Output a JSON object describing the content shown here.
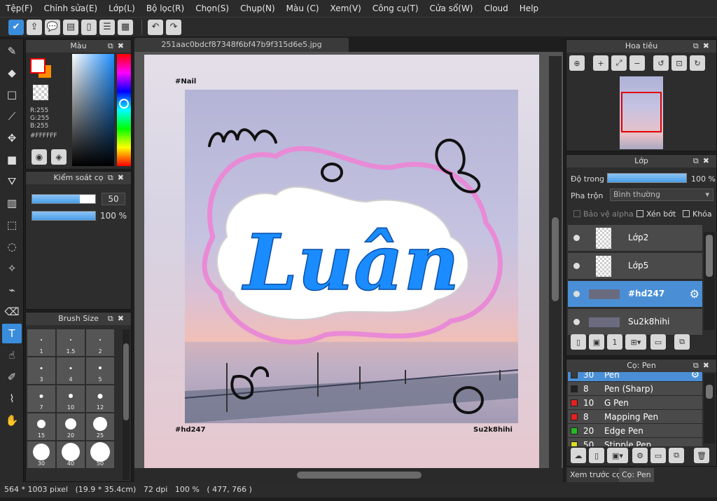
{
  "menu": [
    "Tệp(F)",
    "Chỉnh sửa(E)",
    "Lớp(L)",
    "Bộ lọc(R)",
    "Chọn(S)",
    "Chụp(N)",
    "Màu (C)",
    "Xem(V)",
    "Công cụ(T)",
    "Cửa sổ(W)",
    "Cloud",
    "Help"
  ],
  "toolbar": {
    "icons": [
      "check-icon",
      "share-icon",
      "speech-bubble-icon",
      "comment-icon",
      "page-icon",
      "list-icon",
      "grid-edit-icon",
      "undo-icon",
      "redo-icon"
    ]
  },
  "tools": [
    "brush-icon",
    "eraser-icon",
    "rect-icon",
    "line-icon",
    "move-icon",
    "fill-rect-icon",
    "bucket-icon",
    "gradient-icon",
    "select-rect-icon",
    "lasso-icon",
    "magic-wand-icon",
    "select-pen-icon",
    "select-eraser-icon",
    "text-icon",
    "hand-pointer-icon",
    "dropper-edit-icon",
    "eyedropper-icon",
    "hand-icon"
  ],
  "color_panel": {
    "title": "Màu",
    "r": "R:255",
    "g": "G:255",
    "b": "B:255",
    "hex": "#FFFFFF",
    "fg_color": "#ffffff",
    "bg_color": "#ff8c00"
  },
  "brush_control": {
    "title": "Kiểm soát cọ",
    "size_value": "50",
    "opacity_value": "100 %"
  },
  "brush_size": {
    "title": "Brush Size",
    "sizes": [
      "1",
      "1.5",
      "2",
      "3",
      "4",
      "5",
      "7",
      "10",
      "12",
      "15",
      "20",
      "25",
      "30",
      "40",
      "50"
    ]
  },
  "document": {
    "tab": "251aac0bdcf87348f6bf47b9f315d6e5.jpg",
    "tag_top": "#Nail",
    "tag_bottom_left": "#hd247",
    "tag_bottom_right": "Su2k8hihi",
    "title_text": "Luân",
    "accent_blue": "#1a8cff",
    "accent_pink": "#e98ad6"
  },
  "status": {
    "dimensions": "564 * 1003 pixel",
    "physical": "(19.9 * 35.4cm)",
    "dpi": "72 dpi",
    "zoom": "100 %",
    "coords": "( 477, 766 )"
  },
  "navigator": {
    "title": "Hoa tiêu"
  },
  "layers": {
    "title": "Lớp",
    "opacity_label": "Độ trong",
    "opacity_value": "100 %",
    "blend_label": "Pha trộn",
    "blend_value": "Bình thường",
    "protect_alpha": "Bảo vệ alpha",
    "clip": "Xén bớt",
    "lock": "Khóa",
    "items": [
      {
        "name": "Lớp2",
        "selected": false
      },
      {
        "name": "Lớp5",
        "selected": false
      },
      {
        "name": "#hd247",
        "selected": true
      },
      {
        "name": "Su2k8hihi",
        "selected": false
      }
    ]
  },
  "brushes": {
    "title": "Cọ: Pen",
    "items": [
      {
        "size": "30",
        "name": "Pen",
        "color": "#3a3a3a"
      },
      {
        "size": "8",
        "name": "Pen (Sharp)",
        "color": "#222222"
      },
      {
        "size": "10",
        "name": "G Pen",
        "color": "#e82020"
      },
      {
        "size": "8",
        "name": "Mapping Pen",
        "color": "#e82020"
      },
      {
        "size": "20",
        "name": "Edge Pen",
        "color": "#22bb22"
      },
      {
        "size": "50",
        "name": "Stipple Pen",
        "color": "#dddd22"
      }
    ]
  },
  "bottom_tabs": [
    "Xem trước cọ",
    "Cọ: Pen"
  ]
}
